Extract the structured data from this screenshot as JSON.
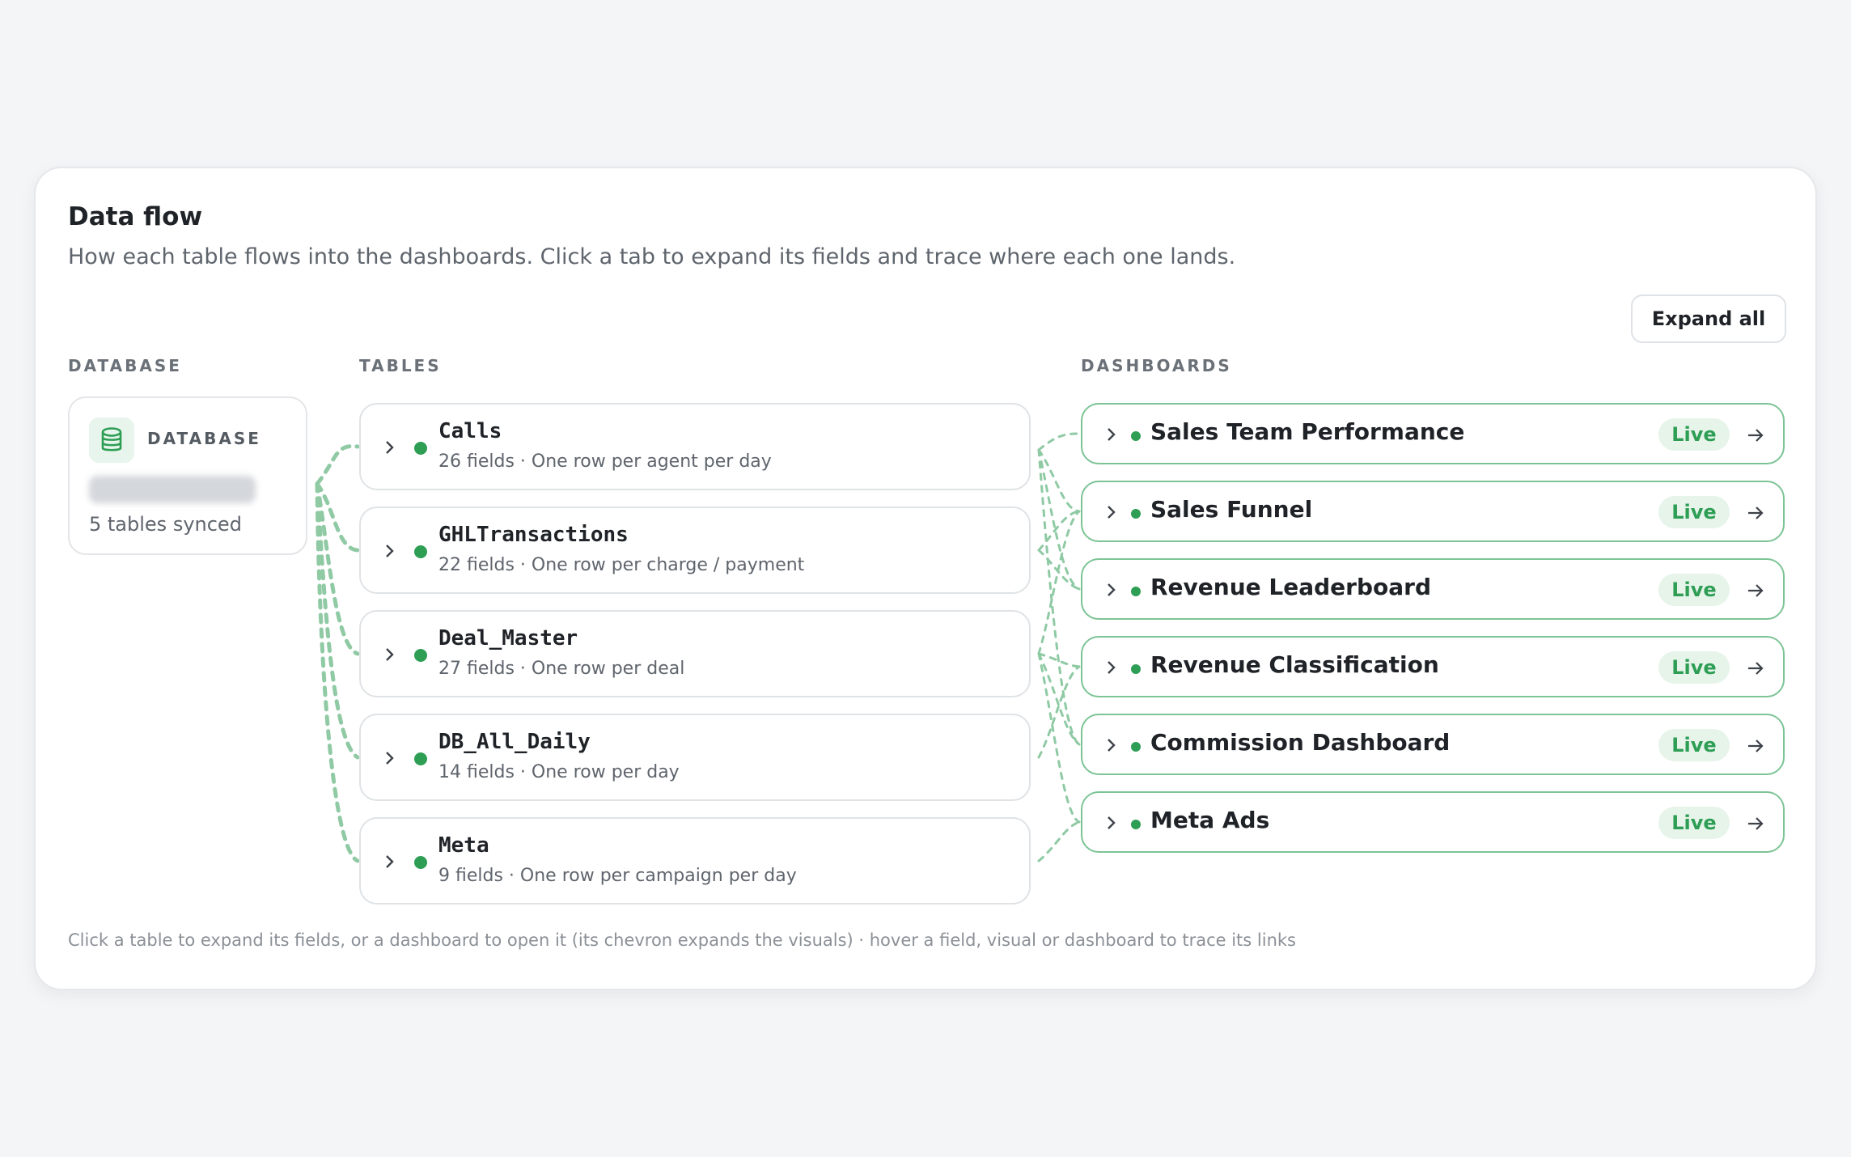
{
  "header": {
    "title": "Data flow",
    "subtitle": "How each table flows into the dashboards. Click a tab to expand its fields and trace where each one lands."
  },
  "toolbar": {
    "expand_all_label": "Expand all"
  },
  "columns": {
    "database_heading": "DATABASE",
    "tables_heading": "TABLES",
    "dashboards_heading": "DASHBOARDS"
  },
  "database": {
    "label": "DATABASE",
    "icon": "database-icon",
    "status": "5 tables synced"
  },
  "tables": [
    {
      "name": "Calls",
      "meta": "26 fields · One row per agent per day"
    },
    {
      "name": "GHLTransactions",
      "meta": "22 fields · One row per charge / payment"
    },
    {
      "name": "Deal_Master",
      "meta": "27 fields · One row per deal"
    },
    {
      "name": "DB_All_Daily",
      "meta": "14 fields · One row per day"
    },
    {
      "name": "Meta",
      "meta": "9 fields · One row per campaign per day"
    }
  ],
  "dashboards": [
    {
      "name": "Sales Team Performance",
      "status": "Live"
    },
    {
      "name": "Sales Funnel",
      "status": "Live"
    },
    {
      "name": "Revenue Leaderboard",
      "status": "Live"
    },
    {
      "name": "Revenue Classification",
      "status": "Live"
    },
    {
      "name": "Commission Dashboard",
      "status": "Live"
    },
    {
      "name": "Meta Ads",
      "status": "Live"
    }
  ],
  "footer": {
    "hint": "Click a table to expand its fields, or a dashboard to open it (its chevron expands the visuals) · hover a field, visual or dashboard to trace its links"
  },
  "colors": {
    "accent": "#2e9e55",
    "link_line": "#8fcaa4",
    "dashboard_border": "#7cc495",
    "badge_bg": "#e6f4ea"
  }
}
